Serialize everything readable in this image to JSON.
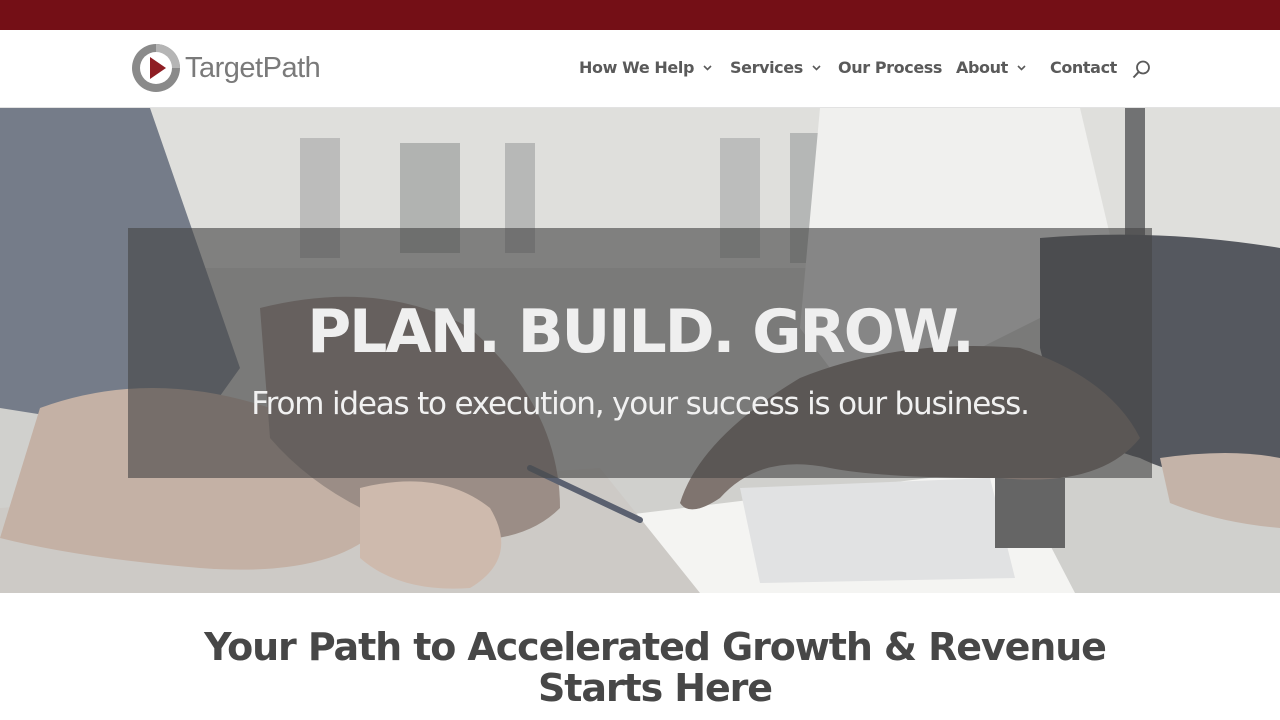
{
  "brand": {
    "name": "TargetPath",
    "colors": {
      "topbar": "#740f16",
      "logo_red": "#8e1d23",
      "logo_gray": "#7a7a7a"
    }
  },
  "nav": {
    "items": [
      {
        "label": "How We Help",
        "has_dropdown": true
      },
      {
        "label": "Services",
        "has_dropdown": true
      },
      {
        "label": "Our Process",
        "has_dropdown": false
      },
      {
        "label": "About",
        "has_dropdown": true
      },
      {
        "label": "Contact",
        "has_dropdown": false
      }
    ],
    "search_icon": "search-icon"
  },
  "hero": {
    "title": "PLAN. BUILD. GROW.",
    "subtitle": "From ideas to execution, your success is our business."
  },
  "section": {
    "title": "Your Path to Accelerated Growth & Revenue Starts Here"
  }
}
